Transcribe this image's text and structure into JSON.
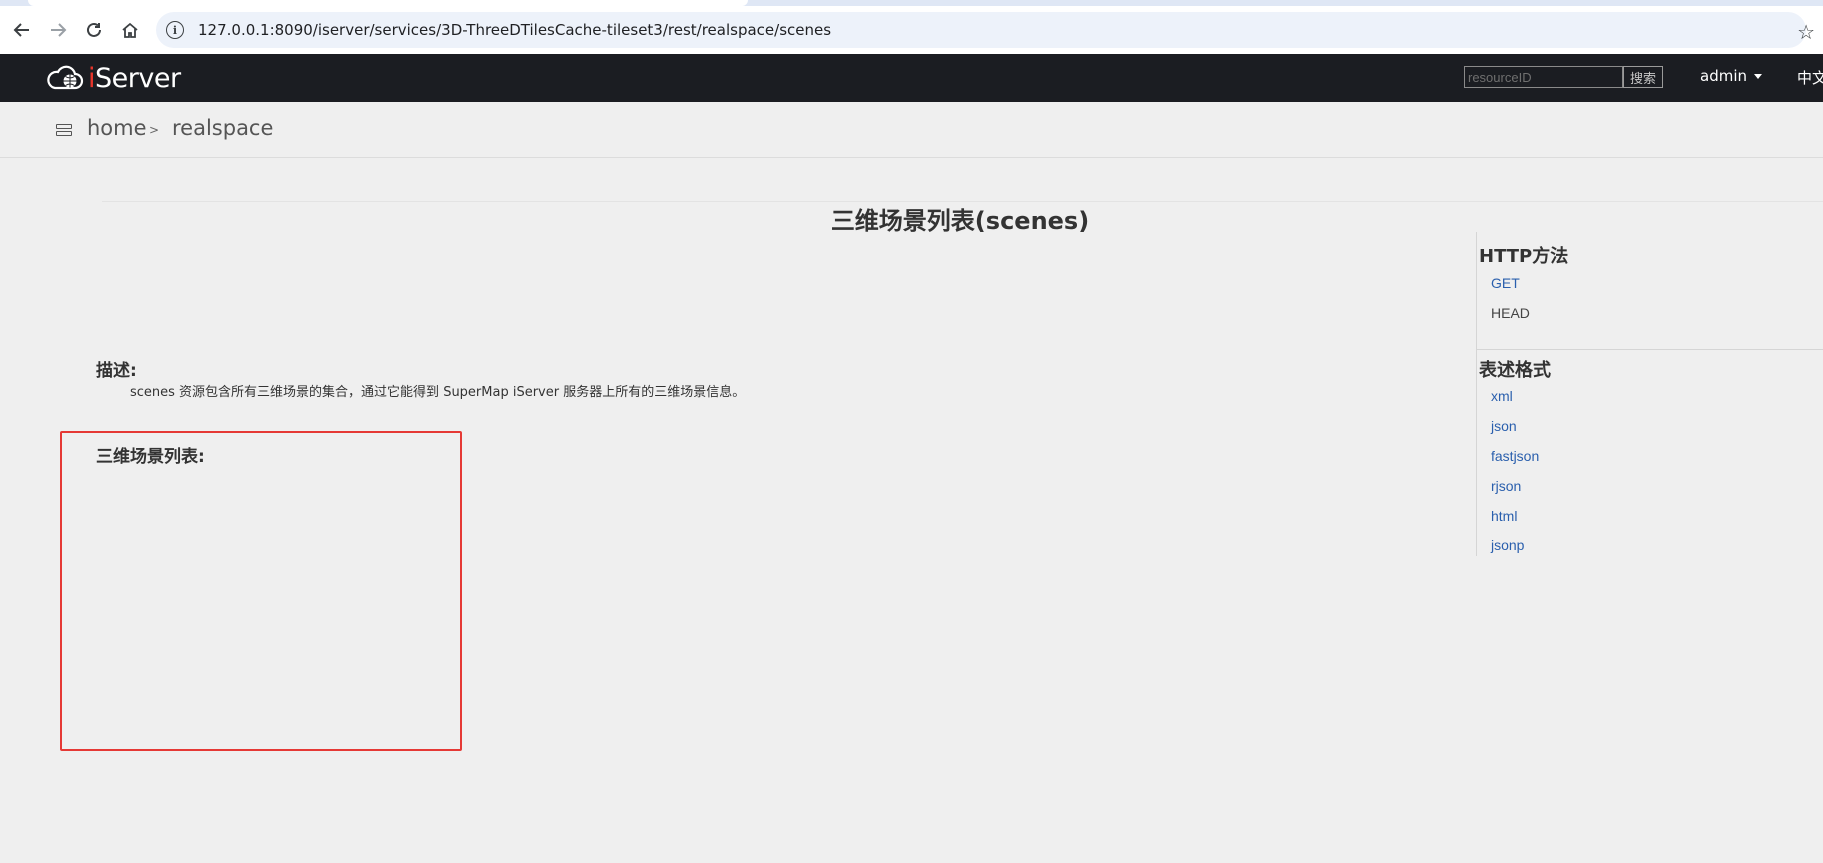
{
  "browser": {
    "url": "127.0.0.1:8090/iserver/services/3D-ThreeDTilesCache-tileset3/rest/realspace/scenes"
  },
  "header": {
    "logo_prefix": "i",
    "logo_suffix": "Server",
    "search_placeholder": "resourceID",
    "search_button": "搜索",
    "user": "admin",
    "language": "中文"
  },
  "breadcrumb": {
    "home": "home",
    "separator": ">",
    "current": "realspace"
  },
  "main": {
    "title": "三维场景列表(scenes)",
    "description_heading": "描述:",
    "description_text": "scenes 资源包含所有三维场景的集合，通过它能得到 SuperMap iServer 服务器上所有的三维场景信息。",
    "list_heading": "三维场景列表:"
  },
  "sidebar": {
    "http_heading": "HTTP方法",
    "http_methods": [
      {
        "label": "GET",
        "link": true
      },
      {
        "label": "HEAD",
        "link": false
      }
    ],
    "format_heading": "表述格式",
    "formats": [
      "xml",
      "json",
      "fastjson",
      "rjson",
      "html",
      "jsonp"
    ]
  },
  "colors": {
    "appbar": "#1b1d22",
    "link": "#2a5fad",
    "highlight": "#e53935",
    "logo_accent": "#e8352b"
  }
}
